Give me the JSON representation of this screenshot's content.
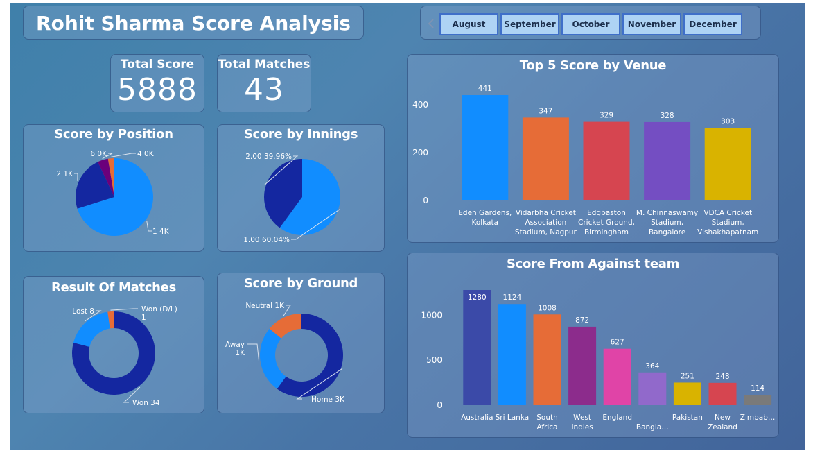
{
  "header": {
    "title": "Rohit Sharma Score Analysis"
  },
  "months": [
    "August",
    "September",
    "October",
    "November",
    "December"
  ],
  "kpis": {
    "total_score": {
      "label": "Total Score",
      "value": "5888"
    },
    "total_matches": {
      "label": "Total Matches",
      "value": "43"
    }
  },
  "icons": {
    "slicer_prev": "chevron-left-icon"
  },
  "colors": {
    "dark_blue": "#1427a0",
    "blue": "#118dff",
    "orange": "#e66c37",
    "purple": "#6b007b"
  },
  "chart_data": [
    {
      "id": "position",
      "type": "pie",
      "title": "Score by Position",
      "slices": [
        {
          "label": "1 4K",
          "value": 4000,
          "color": "#118dff"
        },
        {
          "label": "2 1K",
          "value": 1300,
          "color": "#1427a0"
        },
        {
          "label": "6 0K",
          "value": 250,
          "color": "#6b007b"
        },
        {
          "label": "4 0K",
          "value": 150,
          "color": "#e66c37"
        }
      ]
    },
    {
      "id": "innings",
      "type": "pie",
      "title": "Score by Innings",
      "slices": [
        {
          "label": "1.00 60.04%",
          "value": 60.04,
          "color": "#118dff"
        },
        {
          "label": "2.00 39.96%",
          "value": 39.96,
          "color": "#1427a0"
        }
      ]
    },
    {
      "id": "result",
      "type": "pie",
      "title": "Result Of Matches",
      "slices": [
        {
          "label": "Won 34",
          "value": 34,
          "color": "#1427a0"
        },
        {
          "label": "Lost 8",
          "value": 8,
          "color": "#118dff"
        },
        {
          "label": "Won (D/L)",
          "label2": "1",
          "value": 1,
          "color": "#e66c37"
        }
      ]
    },
    {
      "id": "ground",
      "type": "pie",
      "title": "Score by Ground",
      "slices": [
        {
          "label": "Home 3K",
          "value": 3000,
          "color": "#1427a0"
        },
        {
          "label": "Away",
          "label2": "1K",
          "value": 1300,
          "color": "#118dff"
        },
        {
          "label": "Neutral 1K",
          "value": 700,
          "color": "#e66c37"
        }
      ]
    },
    {
      "id": "venue",
      "type": "bar",
      "title": "Top 5 Score by Venue",
      "categories": [
        [
          "Eden Gardens,",
          "Kolkata"
        ],
        [
          "Vidarbha Cricket",
          "Association",
          "Stadium, Nagpur"
        ],
        [
          "Edgbaston",
          "Cricket Ground,",
          "Birmingham"
        ],
        [
          "M. Chinnaswamy",
          "Stadium,",
          "Bangalore"
        ],
        [
          "VDCA Cricket",
          "Stadium,",
          "Vishakhapatnam"
        ]
      ],
      "values": [
        441,
        347,
        329,
        328,
        303
      ],
      "colors": [
        "#118dff",
        "#e66c37",
        "#d64550",
        "#744ec2",
        "#d9b300"
      ],
      "y_ticks": [
        0,
        200,
        400
      ],
      "ylim": [
        0,
        441
      ]
    },
    {
      "id": "team",
      "type": "bar",
      "title": "Score From Against team",
      "categories": [
        [
          "Australia"
        ],
        [
          "Sri Lanka"
        ],
        [
          "South",
          "Africa"
        ],
        [
          "West",
          "Indies"
        ],
        [
          "England"
        ],
        [
          "Bangla…"
        ],
        [
          "Pakistan"
        ],
        [
          "New",
          "Zealand"
        ],
        [
          "Zimbab…"
        ]
      ],
      "values": [
        1280,
        1124,
        1008,
        872,
        627,
        364,
        251,
        248,
        114
      ],
      "colors": [
        "#3b4aa8",
        "#118dff",
        "#e66c37",
        "#8c2c8c",
        "#e044a7",
        "#9169cb",
        "#d9b300",
        "#d64550",
        "#7a7a7a"
      ],
      "y_ticks": [
        0,
        500,
        1000
      ],
      "ylim": [
        0,
        1280
      ]
    }
  ]
}
